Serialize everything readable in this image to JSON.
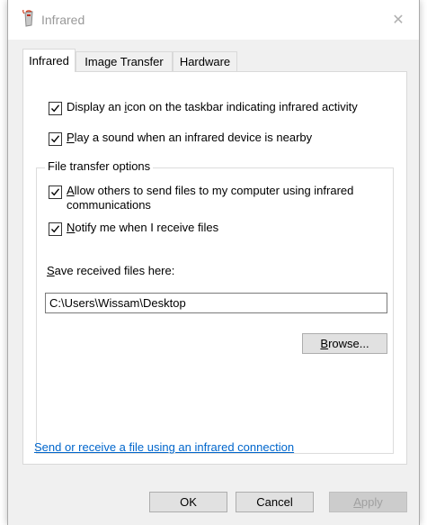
{
  "window": {
    "title": "Infrared",
    "close_glyph": "✕"
  },
  "tabs": [
    {
      "label": "Infrared",
      "active": true
    },
    {
      "label": "Image Transfer",
      "active": false
    },
    {
      "label": "Hardware",
      "active": false
    }
  ],
  "options": {
    "display_icon": {
      "mnemonic": "",
      "label_before": "Display an ",
      "key": "i",
      "label_after": "con on the taskbar indicating infrared activity",
      "checked": true
    },
    "play_sound": {
      "label_before": "",
      "key": "P",
      "label_after": "lay a sound when an infrared device is nearby",
      "checked": true
    }
  },
  "file_transfer": {
    "group_title": "File transfer options",
    "allow_others": {
      "label_before": "",
      "key": "A",
      "label_after": "llow others to send files to my computer using infrared",
      "label_line2": "communications",
      "checked": true
    },
    "notify": {
      "label_before": "",
      "key": "N",
      "label_after": "otify me when I receive files",
      "checked": true
    },
    "save_label": {
      "key": "S",
      "rest": "ave received files here:"
    },
    "save_path": "C:\\Users\\Wissam\\Desktop",
    "browse": {
      "key": "B",
      "rest": "rowse..."
    }
  },
  "link": "Send or receive a file using an infrared connection",
  "buttons": {
    "ok": "OK",
    "cancel": "Cancel",
    "apply": {
      "key": "A",
      "rest": "pply"
    }
  },
  "icons": {
    "title": "infrared-app-icon",
    "check": "checkmark-icon",
    "close": "close-icon"
  }
}
